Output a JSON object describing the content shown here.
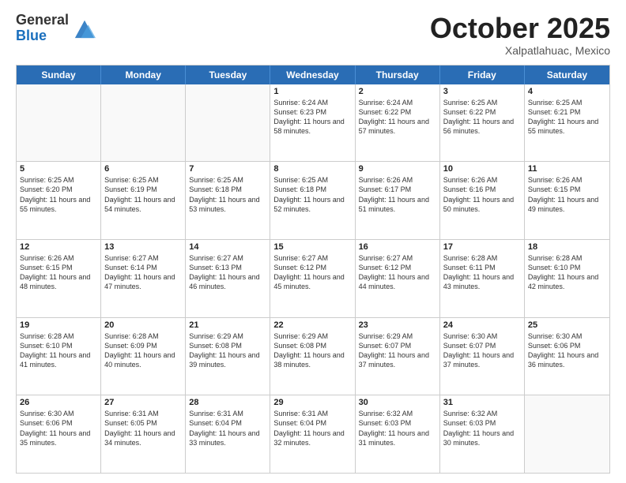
{
  "header": {
    "logo_general": "General",
    "logo_blue": "Blue",
    "month": "October 2025",
    "location": "Xalpatlahuac, Mexico"
  },
  "days_of_week": [
    "Sunday",
    "Monday",
    "Tuesday",
    "Wednesday",
    "Thursday",
    "Friday",
    "Saturday"
  ],
  "weeks": [
    [
      {
        "day": "",
        "info": ""
      },
      {
        "day": "",
        "info": ""
      },
      {
        "day": "",
        "info": ""
      },
      {
        "day": "1",
        "info": "Sunrise: 6:24 AM\nSunset: 6:23 PM\nDaylight: 11 hours and 58 minutes."
      },
      {
        "day": "2",
        "info": "Sunrise: 6:24 AM\nSunset: 6:22 PM\nDaylight: 11 hours and 57 minutes."
      },
      {
        "day": "3",
        "info": "Sunrise: 6:25 AM\nSunset: 6:22 PM\nDaylight: 11 hours and 56 minutes."
      },
      {
        "day": "4",
        "info": "Sunrise: 6:25 AM\nSunset: 6:21 PM\nDaylight: 11 hours and 55 minutes."
      }
    ],
    [
      {
        "day": "5",
        "info": "Sunrise: 6:25 AM\nSunset: 6:20 PM\nDaylight: 11 hours and 55 minutes."
      },
      {
        "day": "6",
        "info": "Sunrise: 6:25 AM\nSunset: 6:19 PM\nDaylight: 11 hours and 54 minutes."
      },
      {
        "day": "7",
        "info": "Sunrise: 6:25 AM\nSunset: 6:18 PM\nDaylight: 11 hours and 53 minutes."
      },
      {
        "day": "8",
        "info": "Sunrise: 6:25 AM\nSunset: 6:18 PM\nDaylight: 11 hours and 52 minutes."
      },
      {
        "day": "9",
        "info": "Sunrise: 6:26 AM\nSunset: 6:17 PM\nDaylight: 11 hours and 51 minutes."
      },
      {
        "day": "10",
        "info": "Sunrise: 6:26 AM\nSunset: 6:16 PM\nDaylight: 11 hours and 50 minutes."
      },
      {
        "day": "11",
        "info": "Sunrise: 6:26 AM\nSunset: 6:15 PM\nDaylight: 11 hours and 49 minutes."
      }
    ],
    [
      {
        "day": "12",
        "info": "Sunrise: 6:26 AM\nSunset: 6:15 PM\nDaylight: 11 hours and 48 minutes."
      },
      {
        "day": "13",
        "info": "Sunrise: 6:27 AM\nSunset: 6:14 PM\nDaylight: 11 hours and 47 minutes."
      },
      {
        "day": "14",
        "info": "Sunrise: 6:27 AM\nSunset: 6:13 PM\nDaylight: 11 hours and 46 minutes."
      },
      {
        "day": "15",
        "info": "Sunrise: 6:27 AM\nSunset: 6:12 PM\nDaylight: 11 hours and 45 minutes."
      },
      {
        "day": "16",
        "info": "Sunrise: 6:27 AM\nSunset: 6:12 PM\nDaylight: 11 hours and 44 minutes."
      },
      {
        "day": "17",
        "info": "Sunrise: 6:28 AM\nSunset: 6:11 PM\nDaylight: 11 hours and 43 minutes."
      },
      {
        "day": "18",
        "info": "Sunrise: 6:28 AM\nSunset: 6:10 PM\nDaylight: 11 hours and 42 minutes."
      }
    ],
    [
      {
        "day": "19",
        "info": "Sunrise: 6:28 AM\nSunset: 6:10 PM\nDaylight: 11 hours and 41 minutes."
      },
      {
        "day": "20",
        "info": "Sunrise: 6:28 AM\nSunset: 6:09 PM\nDaylight: 11 hours and 40 minutes."
      },
      {
        "day": "21",
        "info": "Sunrise: 6:29 AM\nSunset: 6:08 PM\nDaylight: 11 hours and 39 minutes."
      },
      {
        "day": "22",
        "info": "Sunrise: 6:29 AM\nSunset: 6:08 PM\nDaylight: 11 hours and 38 minutes."
      },
      {
        "day": "23",
        "info": "Sunrise: 6:29 AM\nSunset: 6:07 PM\nDaylight: 11 hours and 37 minutes."
      },
      {
        "day": "24",
        "info": "Sunrise: 6:30 AM\nSunset: 6:07 PM\nDaylight: 11 hours and 37 minutes."
      },
      {
        "day": "25",
        "info": "Sunrise: 6:30 AM\nSunset: 6:06 PM\nDaylight: 11 hours and 36 minutes."
      }
    ],
    [
      {
        "day": "26",
        "info": "Sunrise: 6:30 AM\nSunset: 6:06 PM\nDaylight: 11 hours and 35 minutes."
      },
      {
        "day": "27",
        "info": "Sunrise: 6:31 AM\nSunset: 6:05 PM\nDaylight: 11 hours and 34 minutes."
      },
      {
        "day": "28",
        "info": "Sunrise: 6:31 AM\nSunset: 6:04 PM\nDaylight: 11 hours and 33 minutes."
      },
      {
        "day": "29",
        "info": "Sunrise: 6:31 AM\nSunset: 6:04 PM\nDaylight: 11 hours and 32 minutes."
      },
      {
        "day": "30",
        "info": "Sunrise: 6:32 AM\nSunset: 6:03 PM\nDaylight: 11 hours and 31 minutes."
      },
      {
        "day": "31",
        "info": "Sunrise: 6:32 AM\nSunset: 6:03 PM\nDaylight: 11 hours and 30 minutes."
      },
      {
        "day": "",
        "info": ""
      }
    ]
  ]
}
